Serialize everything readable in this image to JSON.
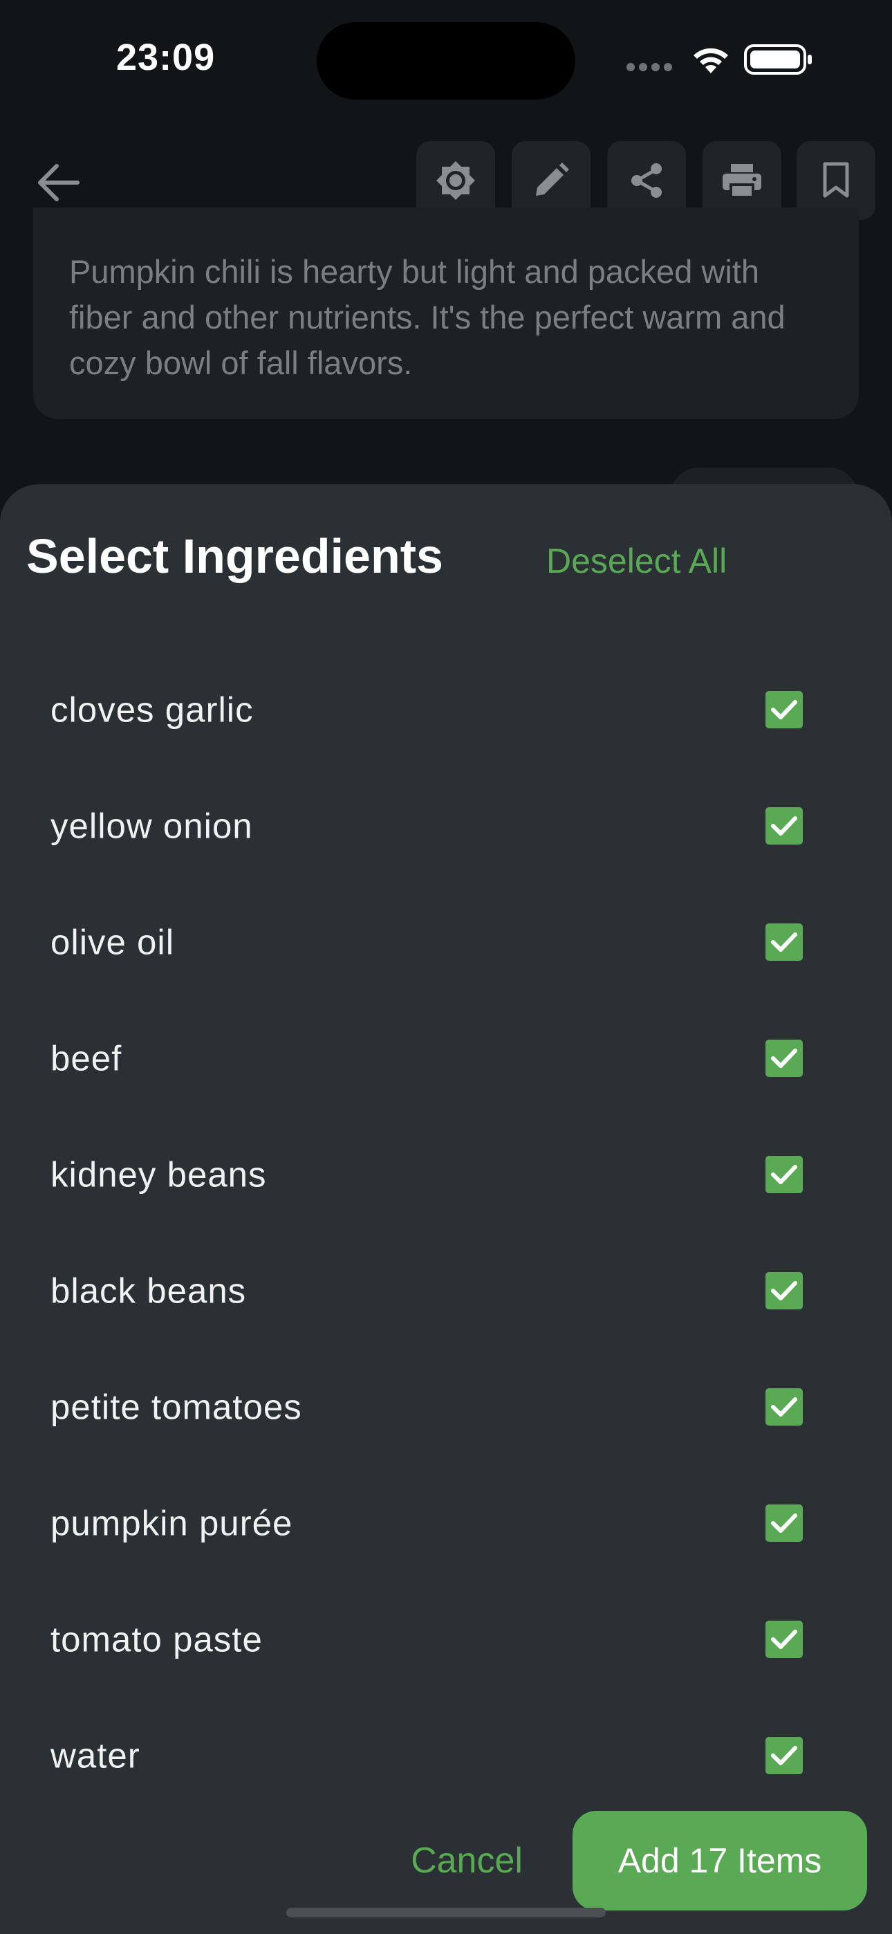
{
  "status_bar": {
    "time": "23:09"
  },
  "toolbar": {
    "back_icon": "arrow-left-icon",
    "buttons": [
      {
        "name": "brightness-button",
        "icon": "brightness-icon"
      },
      {
        "name": "edit-button",
        "icon": "pencil-icon"
      },
      {
        "name": "share-button",
        "icon": "share-icon"
      },
      {
        "name": "print-button",
        "icon": "printer-icon"
      },
      {
        "name": "bookmark-button",
        "icon": "bookmark-icon"
      }
    ]
  },
  "recipe": {
    "description": "Pumpkin chili is hearty but light and packed with fiber and other nutrients. It's the perfect warm and cozy bowl of fall flavors."
  },
  "sheet": {
    "title": "Select Ingredients",
    "deselect_all": "Deselect All",
    "ingredients": [
      {
        "label": "cloves garlic",
        "checked": true
      },
      {
        "label": "yellow onion",
        "checked": true
      },
      {
        "label": "olive oil",
        "checked": true
      },
      {
        "label": "beef",
        "checked": true
      },
      {
        "label": "kidney beans",
        "checked": true
      },
      {
        "label": "black beans",
        "checked": true
      },
      {
        "label": "petite tomatoes",
        "checked": true
      },
      {
        "label": "pumpkin purée",
        "checked": true
      },
      {
        "label": "tomato paste",
        "checked": true
      },
      {
        "label": "water",
        "checked": true
      }
    ],
    "cancel_label": "Cancel",
    "add_label": "Add 17 Items"
  },
  "colors": {
    "accent": "#5aaa55",
    "sheet_bg": "#2a3033",
    "page_bg": "#121518"
  }
}
